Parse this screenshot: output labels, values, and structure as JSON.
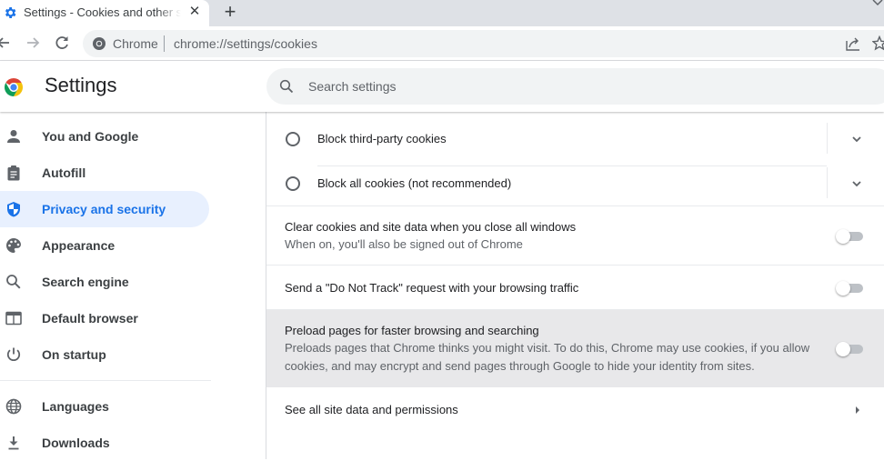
{
  "browser": {
    "tab": {
      "title": "Settings - Cookies and other site data",
      "favicon": "gear-icon",
      "close_icon": "close-icon"
    },
    "new_tab_icon": "plus-icon",
    "toolbar": {
      "back_icon": "back-arrow-icon",
      "forward_icon": "forward-arrow-icon",
      "reload_icon": "reload-icon",
      "omnibox": {
        "origin_label": "Chrome",
        "url": "chrome://settings/cookies",
        "share_icon": "share-icon",
        "bookmark_icon": "star-icon"
      }
    }
  },
  "settings_header": {
    "title": "Settings",
    "search_placeholder": "Search settings"
  },
  "sidebar": {
    "items": [
      {
        "label": "You and Google",
        "icon": "person-icon",
        "active": false
      },
      {
        "label": "Autofill",
        "icon": "clipboard-icon",
        "active": false
      },
      {
        "label": "Privacy and security",
        "icon": "shield-icon",
        "active": true
      },
      {
        "label": "Appearance",
        "icon": "palette-icon",
        "active": false
      },
      {
        "label": "Search engine",
        "icon": "search-icon",
        "active": false
      },
      {
        "label": "Default browser",
        "icon": "browser-window-icon",
        "active": false
      },
      {
        "label": "On startup",
        "icon": "power-icon",
        "active": false
      },
      {
        "label": "Languages",
        "icon": "globe-icon",
        "active": false
      },
      {
        "label": "Downloads",
        "icon": "download-icon",
        "active": false
      }
    ]
  },
  "main": {
    "radio_options": [
      {
        "label": "Block third-party cookies",
        "selected": false
      },
      {
        "label": "Block all cookies (not recommended)",
        "selected": false
      }
    ],
    "toggles": [
      {
        "label": "Clear cookies and site data when you close all windows",
        "sublabel": "When on, you'll also be signed out of Chrome",
        "on": false
      },
      {
        "label": "Send a \"Do Not Track\" request with your browsing traffic",
        "sublabel": "",
        "on": false
      },
      {
        "label": "Preload pages for faster browsing and searching",
        "sublabel": "Preloads pages that Chrome thinks you might visit. To do this, Chrome may use cookies, if you allow cookies, and may encrypt and send pages through Google to hide your identity from sites.",
        "on": false
      }
    ],
    "link_row": {
      "label": "See all site data and permissions"
    }
  },
  "colors": {
    "accent": "#1a73e8",
    "active_nav_bg": "#e8f0fe",
    "hover_row_bg": "#e8e8ea"
  }
}
